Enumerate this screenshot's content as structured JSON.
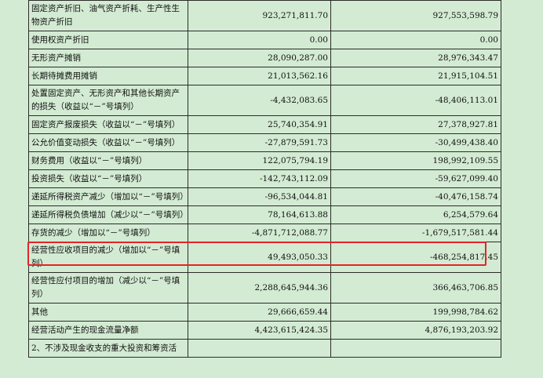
{
  "rows": [
    {
      "label": "固定资产折旧、油气资产折耗、生产性生物资产折旧",
      "current": "923,271,811.70",
      "previous": "927,553,598.79",
      "tall": true
    },
    {
      "label": "使用权资产折旧",
      "current": "0.00",
      "previous": "0.00",
      "tall": false
    },
    {
      "label": "无形资产摊销",
      "current": "28,090,287.00",
      "previous": "28,976,343.47",
      "tall": false
    },
    {
      "label": "长期待摊费用摊销",
      "current": "21,013,562.16",
      "previous": "21,915,104.51",
      "tall": false
    },
    {
      "label": "处置固定资产、无形资产和其他长期资产的损失（收益以“－”号填列）",
      "current": "-4,432,083.65",
      "previous": "-48,406,113.01",
      "tall": true
    },
    {
      "label": "固定资产报废损失（收益以“－”号填列）",
      "current": "25,740,354.91",
      "previous": "27,378,927.81",
      "tall": false
    },
    {
      "label": "公允价值变动损失（收益以“－”号填列）",
      "current": "-27,879,591.73",
      "previous": "-30,499,438.40",
      "tall": false
    },
    {
      "label": "财务费用（收益以“－”号填列）",
      "current": "122,075,794.19",
      "previous": "198,992,109.55",
      "tall": false
    },
    {
      "label": "投资损失（收益以“－”号填列）",
      "current": "-142,743,112.09",
      "previous": "-59,627,099.40",
      "tall": false
    },
    {
      "label": "递延所得税资产减少（增加以“－”号填列）",
      "current": "-96,534,044.81",
      "previous": "-40,476,158.74",
      "tall": false
    },
    {
      "label": "递延所得税负债增加（减少以“－”号填列）",
      "current": "78,164,613.88",
      "previous": "6,254,579.64",
      "tall": false
    },
    {
      "label": "存货的减少（增加以“－”号填列）",
      "current": "-4,871,712,088.77",
      "previous": "-1,679,517,581.44",
      "tall": false
    },
    {
      "label": "经营性应收项目的减少（增加以“－”号填列）",
      "current": "49,493,050.33",
      "previous": "-468,254,817.45",
      "tall": true
    },
    {
      "label": "经营性应付项目的增加（减少以“－”号填列）",
      "current": "2,288,645,944.36",
      "previous": "366,463,706.85",
      "tall": true
    },
    {
      "label": "其他",
      "current": "29,666,659.44",
      "previous": "199,998,784.62",
      "tall": false
    },
    {
      "label": "经营活动产生的现金流量净额",
      "current": "4,423,615,424.35",
      "previous": "4,876,193,203.92",
      "tall": false
    },
    {
      "label": "2、不涉及现金收支的重大投资和筹资活",
      "current": "",
      "previous": "",
      "tall": false
    }
  ],
  "highlight_color": "#e3242b"
}
